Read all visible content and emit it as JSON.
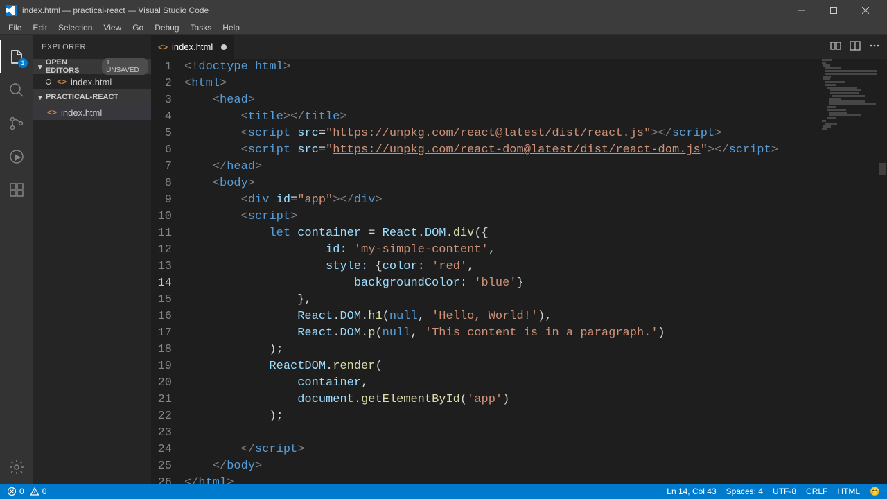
{
  "window": {
    "title": "index.html — practical-react — Visual Studio Code"
  },
  "menubar": [
    "File",
    "Edit",
    "Selection",
    "View",
    "Go",
    "Debug",
    "Tasks",
    "Help"
  ],
  "activitybar": {
    "explorer_badge": "1"
  },
  "sidebar": {
    "title": "EXPLORER",
    "open_editors_label": "OPEN EDITORS",
    "unsaved_badge": "1 UNSAVED",
    "folder_label": "PRACTICAL-REACT",
    "open_editor_file": "index.html",
    "tree_file": "index.html"
  },
  "tab": {
    "label": "index.html"
  },
  "code_lines": [
    {
      "n": 1,
      "segs": [
        [
          "<!",
          "c-punc"
        ],
        [
          "doctype html",
          "c-tag"
        ],
        [
          ">",
          "c-punc"
        ]
      ]
    },
    {
      "n": 2,
      "segs": [
        [
          "<",
          "c-punc"
        ],
        [
          "html",
          "c-tag"
        ],
        [
          ">",
          "c-punc"
        ]
      ]
    },
    {
      "n": 3,
      "segs": [
        [
          "    ",
          "c-white"
        ],
        [
          "<",
          "c-punc"
        ],
        [
          "head",
          "c-tag"
        ],
        [
          ">",
          "c-punc"
        ]
      ]
    },
    {
      "n": 4,
      "segs": [
        [
          "        ",
          "c-white"
        ],
        [
          "<",
          "c-punc"
        ],
        [
          "title",
          "c-tag"
        ],
        [
          "></",
          "c-punc"
        ],
        [
          "title",
          "c-tag"
        ],
        [
          ">",
          "c-punc"
        ]
      ]
    },
    {
      "n": 5,
      "segs": [
        [
          "        ",
          "c-white"
        ],
        [
          "<",
          "c-punc"
        ],
        [
          "script",
          "c-tag"
        ],
        [
          " ",
          "c-white"
        ],
        [
          "src",
          "c-attr"
        ],
        [
          "=",
          "c-white"
        ],
        [
          "\"",
          "c-str"
        ],
        [
          "https://unpkg.com/react@latest/dist/react.js",
          "c-url"
        ],
        [
          "\"",
          "c-str"
        ],
        [
          "></",
          "c-punc"
        ],
        [
          "script",
          "c-tag"
        ],
        [
          ">",
          "c-punc"
        ]
      ]
    },
    {
      "n": 6,
      "segs": [
        [
          "        ",
          "c-white"
        ],
        [
          "<",
          "c-punc"
        ],
        [
          "script",
          "c-tag"
        ],
        [
          " ",
          "c-white"
        ],
        [
          "src",
          "c-attr"
        ],
        [
          "=",
          "c-white"
        ],
        [
          "\"",
          "c-str"
        ],
        [
          "https://unpkg.com/react-dom@latest/dist/react-dom.js",
          "c-url"
        ],
        [
          "\"",
          "c-str"
        ],
        [
          "></",
          "c-punc"
        ],
        [
          "script",
          "c-tag"
        ],
        [
          ">",
          "c-punc"
        ]
      ]
    },
    {
      "n": 7,
      "segs": [
        [
          "    ",
          "c-white"
        ],
        [
          "</",
          "c-punc"
        ],
        [
          "head",
          "c-tag"
        ],
        [
          ">",
          "c-punc"
        ]
      ]
    },
    {
      "n": 8,
      "segs": [
        [
          "    ",
          "c-white"
        ],
        [
          "<",
          "c-punc"
        ],
        [
          "body",
          "c-tag"
        ],
        [
          ">",
          "c-punc"
        ]
      ]
    },
    {
      "n": 9,
      "segs": [
        [
          "        ",
          "c-white"
        ],
        [
          "<",
          "c-punc"
        ],
        [
          "div",
          "c-tag"
        ],
        [
          " ",
          "c-white"
        ],
        [
          "id",
          "c-attr"
        ],
        [
          "=",
          "c-white"
        ],
        [
          "\"app\"",
          "c-str"
        ],
        [
          "></",
          "c-punc"
        ],
        [
          "div",
          "c-tag"
        ],
        [
          ">",
          "c-punc"
        ]
      ]
    },
    {
      "n": 10,
      "segs": [
        [
          "        ",
          "c-white"
        ],
        [
          "<",
          "c-punc"
        ],
        [
          "script",
          "c-tag"
        ],
        [
          ">",
          "c-punc"
        ]
      ]
    },
    {
      "n": 11,
      "segs": [
        [
          "            ",
          "c-white"
        ],
        [
          "let",
          "c-kw"
        ],
        [
          " ",
          "c-white"
        ],
        [
          "container",
          "c-var"
        ],
        [
          " = ",
          "c-white"
        ],
        [
          "React",
          "c-obj"
        ],
        [
          ".",
          "c-white"
        ],
        [
          "DOM",
          "c-obj"
        ],
        [
          ".",
          "c-white"
        ],
        [
          "div",
          "c-func"
        ],
        [
          "({",
          "c-white"
        ]
      ]
    },
    {
      "n": 12,
      "segs": [
        [
          "                    ",
          "c-white"
        ],
        [
          "id:",
          "c-var"
        ],
        [
          " ",
          "c-white"
        ],
        [
          "'my-simple-content'",
          "c-str"
        ],
        [
          ",",
          "c-white"
        ]
      ]
    },
    {
      "n": 13,
      "segs": [
        [
          "                    ",
          "c-white"
        ],
        [
          "style:",
          "c-var"
        ],
        [
          " {",
          "c-white"
        ],
        [
          "color:",
          "c-var"
        ],
        [
          " ",
          "c-white"
        ],
        [
          "'red'",
          "c-str"
        ],
        [
          ",",
          "c-white"
        ]
      ]
    },
    {
      "n": 14,
      "segs": [
        [
          "                        ",
          "c-white"
        ],
        [
          "backgroundColor:",
          "c-var"
        ],
        [
          " ",
          "c-white"
        ],
        [
          "'blue'",
          "c-str"
        ],
        [
          "}",
          "c-white"
        ]
      ]
    },
    {
      "n": 15,
      "segs": [
        [
          "                ",
          "c-white"
        ],
        [
          "},",
          "c-white"
        ]
      ]
    },
    {
      "n": 16,
      "segs": [
        [
          "                ",
          "c-white"
        ],
        [
          "React",
          "c-obj"
        ],
        [
          ".",
          "c-white"
        ],
        [
          "DOM",
          "c-obj"
        ],
        [
          ".",
          "c-white"
        ],
        [
          "h1",
          "c-func"
        ],
        [
          "(",
          "c-white"
        ],
        [
          "null",
          "c-null"
        ],
        [
          ", ",
          "c-white"
        ],
        [
          "'Hello, World!'",
          "c-str"
        ],
        [
          "),",
          "c-white"
        ]
      ]
    },
    {
      "n": 17,
      "segs": [
        [
          "                ",
          "c-white"
        ],
        [
          "React",
          "c-obj"
        ],
        [
          ".",
          "c-white"
        ],
        [
          "DOM",
          "c-obj"
        ],
        [
          ".",
          "c-white"
        ],
        [
          "p",
          "c-func"
        ],
        [
          "(",
          "c-white"
        ],
        [
          "null",
          "c-null"
        ],
        [
          ", ",
          "c-white"
        ],
        [
          "'This content is in a paragraph.'",
          "c-str"
        ],
        [
          ")",
          "c-white"
        ]
      ]
    },
    {
      "n": 18,
      "segs": [
        [
          "            ",
          "c-white"
        ],
        [
          ");",
          "c-white"
        ]
      ]
    },
    {
      "n": 19,
      "segs": [
        [
          "            ",
          "c-white"
        ],
        [
          "ReactDOM",
          "c-obj"
        ],
        [
          ".",
          "c-white"
        ],
        [
          "render",
          "c-func"
        ],
        [
          "(",
          "c-white"
        ]
      ]
    },
    {
      "n": 20,
      "segs": [
        [
          "                ",
          "c-white"
        ],
        [
          "container",
          "c-var"
        ],
        [
          ",",
          "c-white"
        ]
      ]
    },
    {
      "n": 21,
      "segs": [
        [
          "                ",
          "c-white"
        ],
        [
          "document",
          "c-obj"
        ],
        [
          ".",
          "c-white"
        ],
        [
          "getElementById",
          "c-func"
        ],
        [
          "(",
          "c-white"
        ],
        [
          "'app'",
          "c-str"
        ],
        [
          ")",
          "c-white"
        ]
      ]
    },
    {
      "n": 22,
      "segs": [
        [
          "            ",
          "c-white"
        ],
        [
          ");",
          "c-white"
        ]
      ]
    },
    {
      "n": 23,
      "segs": [
        [
          "",
          "c-white"
        ]
      ]
    },
    {
      "n": 24,
      "segs": [
        [
          "        ",
          "c-white"
        ],
        [
          "</",
          "c-punc"
        ],
        [
          "script",
          "c-tag"
        ],
        [
          ">",
          "c-punc"
        ]
      ]
    },
    {
      "n": 25,
      "segs": [
        [
          "    ",
          "c-white"
        ],
        [
          "</",
          "c-punc"
        ],
        [
          "body",
          "c-tag"
        ],
        [
          ">",
          "c-punc"
        ]
      ]
    },
    {
      "n": 26,
      "segs": [
        [
          "</",
          "c-punc"
        ],
        [
          "html",
          "c-tag"
        ],
        [
          ">",
          "c-punc"
        ]
      ]
    }
  ],
  "current_line": 14,
  "status": {
    "errors": "0",
    "warnings": "0",
    "cursor": "Ln 14, Col 43",
    "spaces": "Spaces: 4",
    "encoding": "UTF-8",
    "eol": "CRLF",
    "language": "HTML",
    "feedback": "😊"
  }
}
